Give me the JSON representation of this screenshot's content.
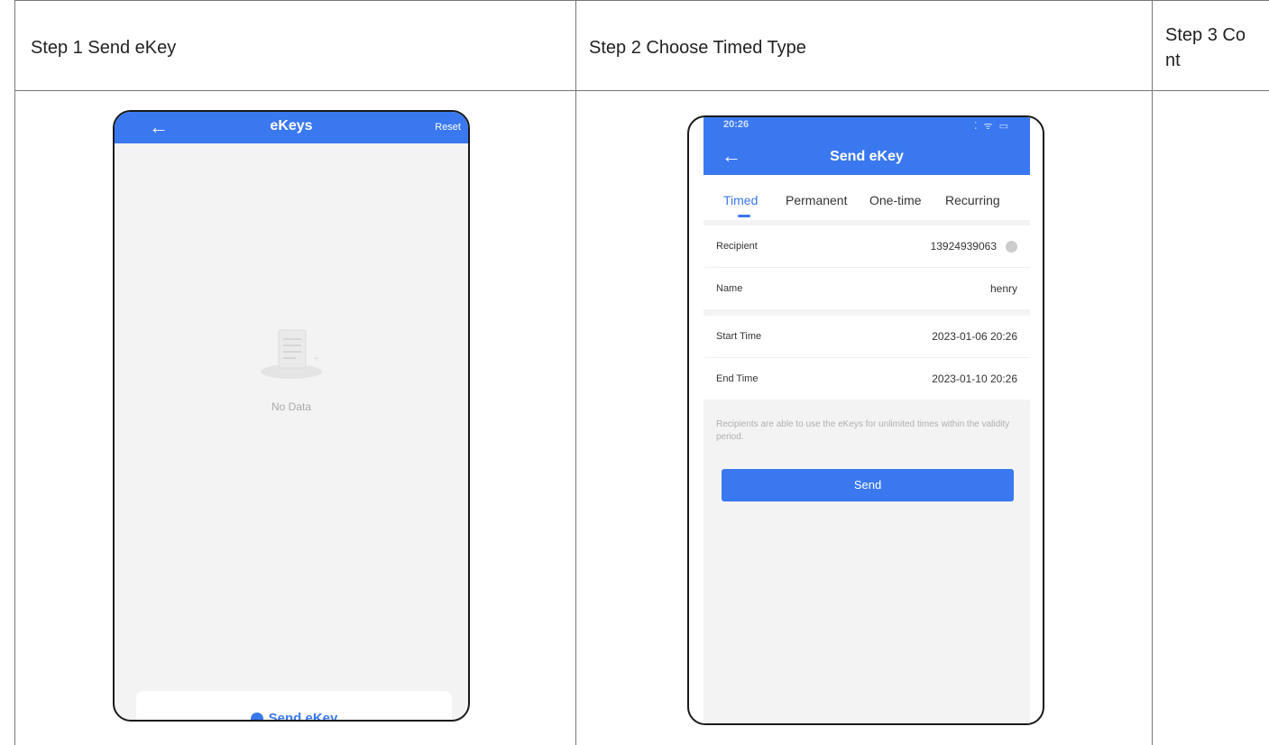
{
  "steps": [
    {
      "label": "Step 1 Send eKey"
    },
    {
      "label": "Step 2 Choose Timed Type"
    },
    {
      "label_line1": "Step 3 Co",
      "label_line2": "nt"
    }
  ],
  "phone1": {
    "title": "eKeys",
    "back_icon": "←",
    "reset_label": "Reset",
    "empty_text": "No Data",
    "send_button_label": "Send eKey"
  },
  "phone2": {
    "status_time": "20:26",
    "status_icons": "⁚ ᯤ ▭",
    "back_icon": "←",
    "title": "Send eKey",
    "tabs": [
      "Timed",
      "Permanent",
      "One-time",
      "Recurring"
    ],
    "active_tab": "Timed",
    "recipient_label": "Recipient",
    "recipient_value": "13924939063",
    "name_label": "Name",
    "name_value": "henry",
    "start_label": "Start Time",
    "start_value": "2023-01-06 20:26",
    "end_label": "End Time",
    "end_value": "2023-01-10 20:26",
    "note": "Recipients are able to use the eKeys for unlimited times within the validity period.",
    "send_label": "Send"
  },
  "colors": {
    "accent": "#3a78ef",
    "background": "#f3f3f3",
    "border": "#777777"
  }
}
